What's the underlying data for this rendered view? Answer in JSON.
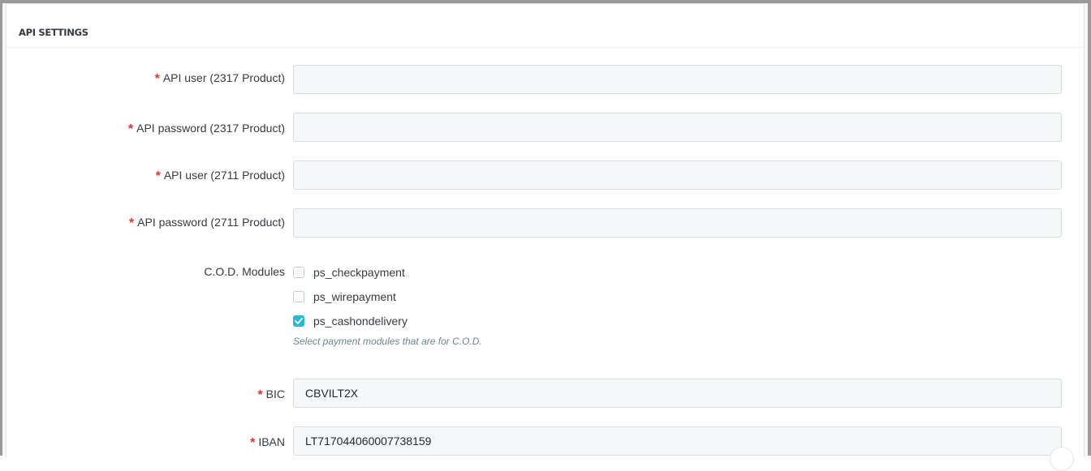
{
  "panel": {
    "title": "API SETTINGS"
  },
  "fields": [
    {
      "required": true,
      "label": "API user (2317 Product)",
      "value": "",
      "placeholder": ""
    },
    {
      "required": true,
      "label": "API password (2317 Product)",
      "value": "",
      "placeholder": ""
    },
    {
      "required": true,
      "label": "API user (2711 Product)",
      "value": "",
      "placeholder": ""
    },
    {
      "required": true,
      "label": "API password (2711 Product)",
      "value": "",
      "placeholder": ""
    }
  ],
  "cod": {
    "label": "C.O.D. Modules",
    "options": [
      {
        "label": "ps_checkpayment",
        "checked": false
      },
      {
        "label": "ps_wirepayment",
        "checked": false
      },
      {
        "label": "ps_cashondelivery",
        "checked": true
      }
    ],
    "help": "Select payment modules that are for C.O.D."
  },
  "bank": {
    "bic": {
      "required": true,
      "label": "BIC",
      "value": "CBVILT2X"
    },
    "iban": {
      "required": true,
      "label": "IBAN",
      "value": "LT717044060007738159"
    }
  },
  "colors": {
    "required_star": "#e5322d",
    "checkbox_checked": "#25b9d7",
    "input_background": "#f5f8f9"
  },
  "required_mark": "*"
}
